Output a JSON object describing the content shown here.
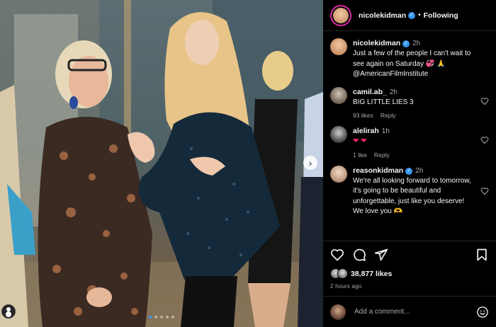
{
  "photo": {
    "carousel_dots": 5,
    "active_dot": 0
  },
  "post": {
    "author": "nicolekidman",
    "separator": "•",
    "follow_status": "Following",
    "caption_time": "2h",
    "caption": "Just a few of the people I can't wait to see again on Saturday 💞 🙏 @AmericanFilmInstitute"
  },
  "comments": [
    {
      "username": "camil.ab_",
      "time": "2h",
      "text": "BIG LITTLE LIES 3",
      "likes": "93 likes",
      "reply": "Reply"
    },
    {
      "username": "alelirah",
      "time": "1h",
      "text": "❤ ❤",
      "likes": "1 like",
      "reply": "Reply"
    },
    {
      "username": "reasonkidman",
      "verified": true,
      "time": "2h",
      "text": "We're all looking forward to tomorrow, it's going to be beautiful and unforgettable, just like you deserve! We love you 🫶",
      "likes": "",
      "reply": ""
    }
  ],
  "actions": {
    "likes_count": "38,877 likes",
    "post_time": "2 hours ago",
    "add_comment_placeholder": "Add a comment..."
  },
  "icons": [
    "heart-icon",
    "comment-icon",
    "share-icon",
    "bookmark-icon",
    "emoji-icon",
    "verified-icon",
    "next-arrow-icon",
    "tag-person-icon"
  ],
  "colors": {
    "verified_blue": "#3897f0",
    "background": "#000000",
    "muted": "#a8a8a8"
  }
}
